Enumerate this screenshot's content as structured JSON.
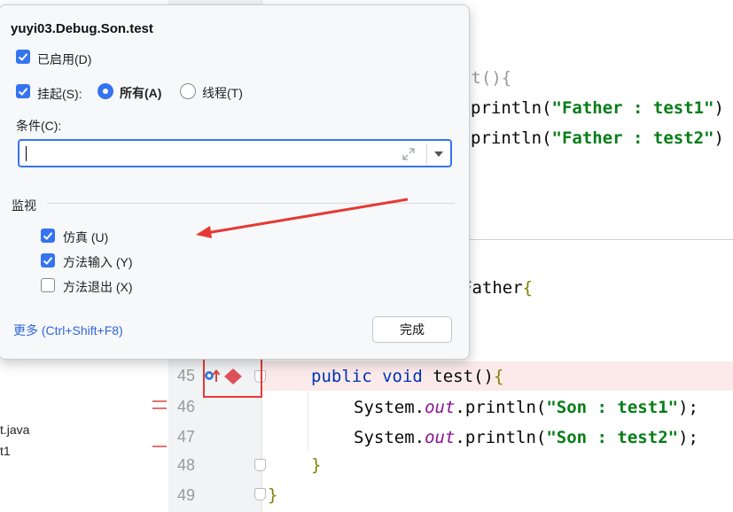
{
  "colors": {
    "accent": "#3574f0",
    "annotation_red": "#e53935",
    "keyword": "#0033b3",
    "string": "#067d17",
    "field": "#871094",
    "breakpoint_line_bg": "#fbeaea"
  },
  "popup": {
    "title": "yuyi03.Debug.Son.test",
    "enabled": {
      "label": "已启用(D)",
      "checked": true
    },
    "suspend": {
      "label": "挂起(S):",
      "checked": true
    },
    "suspend_all": {
      "label": "所有(A)",
      "selected": true
    },
    "suspend_thread": {
      "label": "线程(T)",
      "selected": false
    },
    "condition_label": "条件(C):",
    "condition_value": "",
    "expand_icon": "expand-icon",
    "dropdown_icon": "chevron-down-icon",
    "section_watch": "监视",
    "emulated": {
      "label": "仿真 (U)",
      "checked": true
    },
    "method_entry": {
      "label": "方法输入 (Y)",
      "checked": true
    },
    "method_exit": {
      "label": "方法退出 (X)",
      "checked": false
    },
    "more_link": "更多 (Ctrl+Shift+F8)",
    "done_button": "完成"
  },
  "project": {
    "file_fragment": "t.java",
    "item_fragment": "t1"
  },
  "editor": {
    "upper": {
      "line1_tail": "st(){",
      "line2_call": "println(",
      "line2_str": "\"Father : test1\"",
      "line2_end": ")",
      "line3_call": "println(",
      "line3_str": "\"Father : test2\"",
      "line3_end": ")"
    },
    "class_header": {
      "text": "Father",
      "brace": "{"
    },
    "line_numbers": [
      "45",
      "46",
      "47",
      "48",
      "49"
    ],
    "line45": {
      "kw1": "public",
      "kw2": "void",
      "name": " test",
      "paren": "()",
      "brace": "{"
    },
    "line46": {
      "obj": "System.",
      "field": "out",
      "call": ".println(",
      "str": "\"Son : test1\"",
      "end": ");"
    },
    "line47": {
      "obj": "System.",
      "field": "out",
      "call": ".println(",
      "str": "\"Son : test2\"",
      "end": ");"
    },
    "line48": "}",
    "line49": "}"
  }
}
